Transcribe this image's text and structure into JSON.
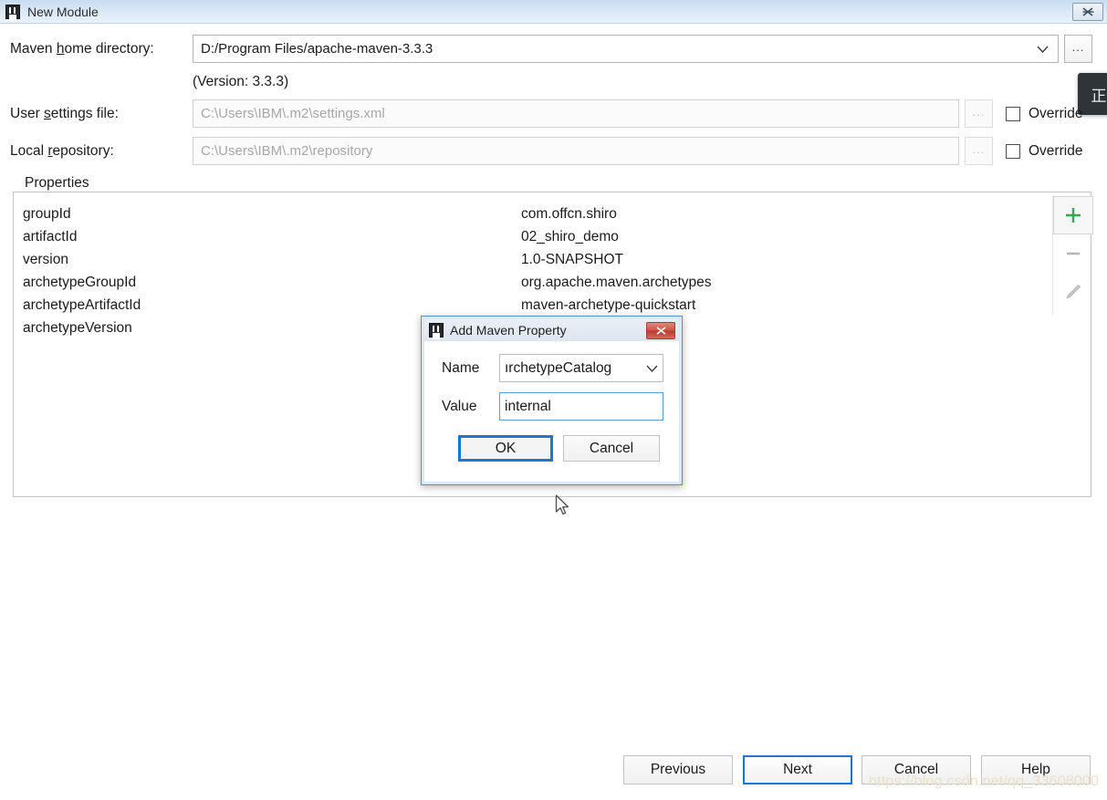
{
  "window": {
    "title": "New Module",
    "icon": "intellij-idea-logo",
    "close_label": "⌧"
  },
  "ime_indicator": {
    "text": "正"
  },
  "fields": {
    "maven_home": {
      "label_prefix": "Maven ",
      "label_mnemonic": "h",
      "label_suffix": "ome directory:",
      "label_full": "Maven home directory:",
      "value": "D:/Program Files/apache-maven-3.3.3",
      "browse_label": "...",
      "version_note": "(Version: 3.3.3)"
    },
    "user_settings": {
      "label_prefix": "User ",
      "label_mnemonic": "s",
      "label_suffix": "ettings file:",
      "label_full": "User settings file:",
      "placeholder": "C:\\Users\\IBM\\.m2\\settings.xml",
      "browse_label": "...",
      "override_label": "Override",
      "override_checked": false
    },
    "local_repository": {
      "label_prefix": "Local ",
      "label_mnemonic": "r",
      "label_suffix": "epository:",
      "label_full": "Local repository:",
      "placeholder": "C:\\Users\\IBM\\.m2\\repository",
      "browse_label": "...",
      "override_label": "Override",
      "override_checked": false
    }
  },
  "properties_panel": {
    "title": "Properties",
    "rows": [
      {
        "name": "groupId",
        "value": "com.offcn.shiro"
      },
      {
        "name": "artifactId",
        "value": "02_shiro_demo"
      },
      {
        "name": "version",
        "value": "1.0-SNAPSHOT"
      },
      {
        "name": "archetypeGroupId",
        "value": "org.apache.maven.archetypes"
      },
      {
        "name": "archetypeArtifactId",
        "value": "maven-archetype-quickstart"
      },
      {
        "name": "archetypeVersion",
        "value": ""
      }
    ],
    "toolbar": {
      "add_label": "+",
      "remove_label": "−",
      "edit_label": "edit",
      "add_color": "#3aa655",
      "remove_color": "#b5b5b5",
      "edit_color": "#b8b8b8"
    }
  },
  "modal": {
    "title": "Add Maven Property",
    "icon": "intellij-idea-logo",
    "close_label": "✕",
    "name_label": "Name",
    "name_value": "archetypeCatalog",
    "name_value_visible": "ırchetypeCatalog",
    "value_label": "Value",
    "value_value": "internal",
    "ok_label": "OK",
    "cancel_label": "Cancel"
  },
  "wizard_buttons": {
    "previous": "Previous",
    "next": "Next",
    "cancel": "Cancel",
    "help": "Help"
  },
  "watermark": {
    "text": "https://blog.csdn.net/qq_33608000"
  },
  "colors": {
    "accent": "#1a78d2",
    "titlebar": "#d9e7f6",
    "add_green": "#3aa655",
    "close_red": "#cf5246"
  }
}
